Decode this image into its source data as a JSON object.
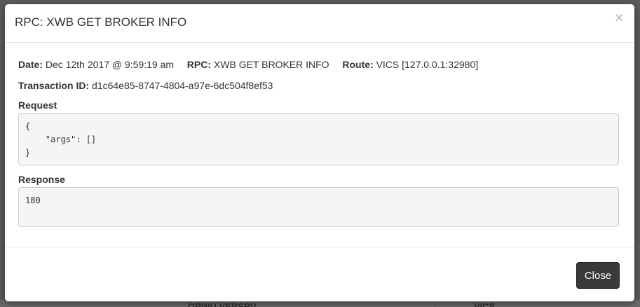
{
  "modal": {
    "title": "RPC: XWB GET BROKER INFO",
    "close_icon": "×",
    "close_button_label": "Close"
  },
  "meta": {
    "date_label": "Date:",
    "date_value": "Dec 12th 2017 @ 9:59:19 am",
    "rpc_label": "RPC:",
    "rpc_value": "XWB GET BROKER INFO",
    "route_label": "Route:",
    "route_value": "VICS [127.0.0.1:32980]",
    "transaction_label": "Transaction ID:",
    "transaction_value": "d1c64e85-8747-4804-a97e-6dc504f8ef53"
  },
  "request": {
    "label": "Request",
    "body": "{\n    \"args\": []\n}"
  },
  "response": {
    "label": "Response",
    "body": "180"
  },
  "background": {
    "left_text": "ORWU VERSRV",
    "right_text": "VICS"
  }
}
